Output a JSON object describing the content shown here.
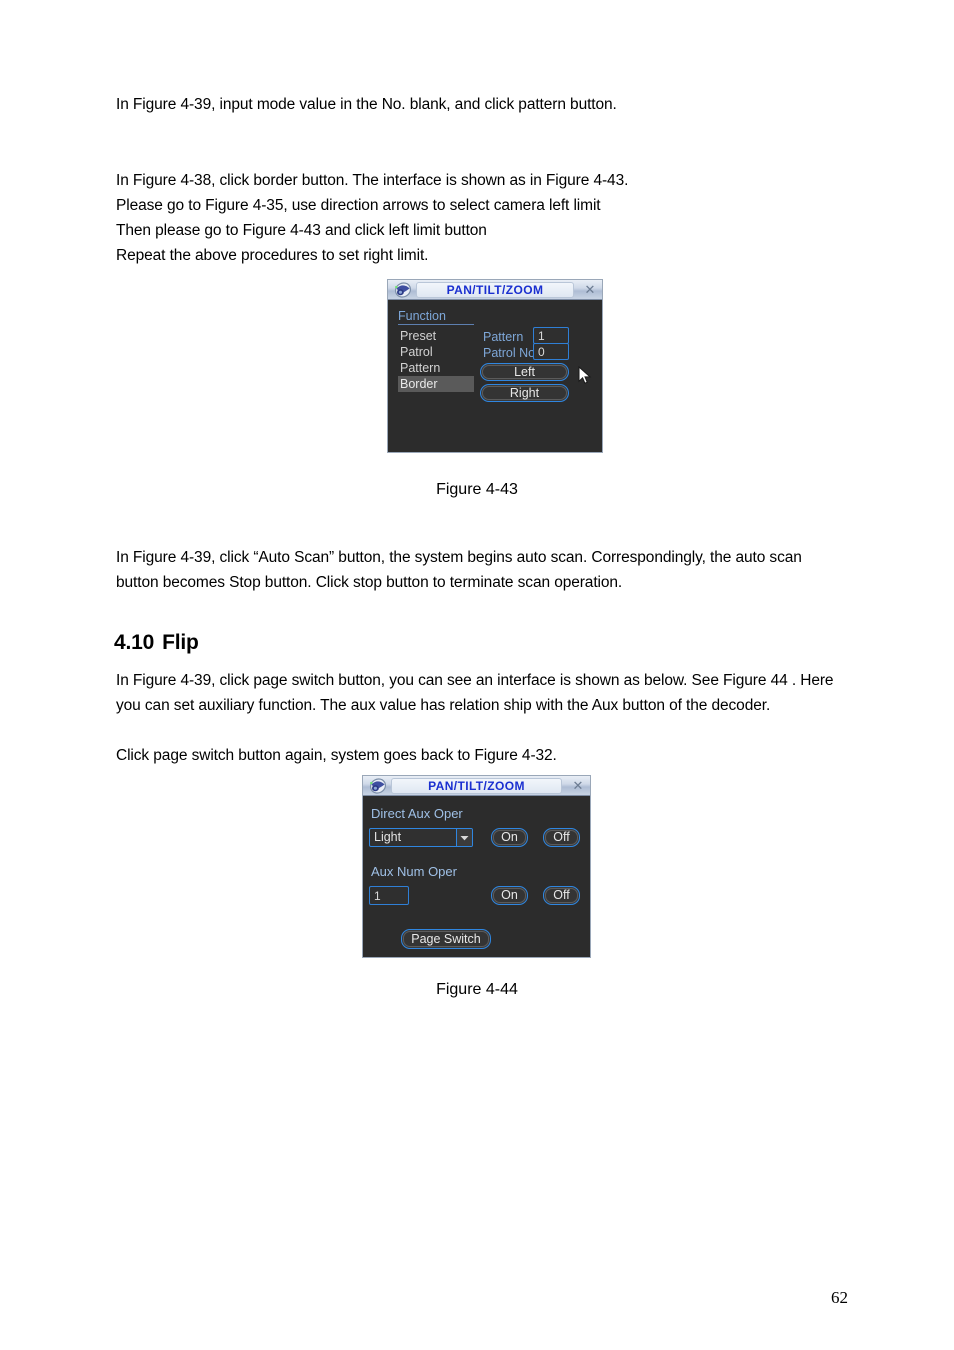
{
  "document": {
    "page_number": "62",
    "paragraphs": {
      "p1": "In Figure 4-39, input mode value in the No. blank, and click pattern button.",
      "p2_line1": "In Figure 4-38, click border button. The interface is shown as in Figure 4-43.",
      "p2_line2": "Please go to Figure 4-35, use direction arrows to select camera left limit",
      "p2_line3": "Then please go to Figure 4-43 and click left limit button",
      "p2_line4": "Repeat the above procedures to set right limit.",
      "p3": "In Figure 4-39, click “Auto Scan” button, the system begins auto scan. Correspondingly, the auto scan button becomes Stop button. Click stop button to terminate scan operation.",
      "p4": "In Figure 4-39, click page switch button, you can see an interface is shown as below. See Figure 44 . Here you can set auxiliary function. The aux value has relation ship with the Aux button of the decoder.",
      "p5": "Click page switch button again, system goes back to Figure 4-32."
    },
    "section": {
      "number": "4.10",
      "title": "Flip"
    },
    "captions": {
      "fig_4_43": "Figure 4-43",
      "fig_4_44": "Figure 4-44"
    }
  },
  "dialog_border": {
    "title": "PAN/TILT/ZOOM",
    "close_label": "✕",
    "function_header": "Function",
    "function_items": [
      {
        "label": "Preset",
        "selected": false
      },
      {
        "label": "Patrol",
        "selected": false
      },
      {
        "label": "Pattern",
        "selected": false
      },
      {
        "label": "Border",
        "selected": true
      }
    ],
    "fields": [
      {
        "label": "Pattern",
        "value": "1"
      },
      {
        "label": "Patrol No.",
        "value": "0"
      }
    ],
    "buttons": [
      {
        "label": "Left"
      },
      {
        "label": "Right"
      }
    ]
  },
  "dialog_aux": {
    "title": "PAN/TILT/ZOOM",
    "close_label": "✕",
    "direct_aux_label": "Direct Aux Oper",
    "direct_aux_select_value": "Light",
    "direct_aux_on": "On",
    "direct_aux_off": "Off",
    "aux_num_label": "Aux Num Oper",
    "aux_num_value": "1",
    "aux_num_on": "On",
    "aux_num_off": "Off",
    "page_switch_label": "Page Switch"
  },
  "colors": {
    "dialog_body": "#2c2c2c",
    "accent_blue": "#2f86e0",
    "label_blue": "#7ea7d8",
    "title_blue": "#1a2fd0",
    "selected_item": "#5a5a5a"
  }
}
